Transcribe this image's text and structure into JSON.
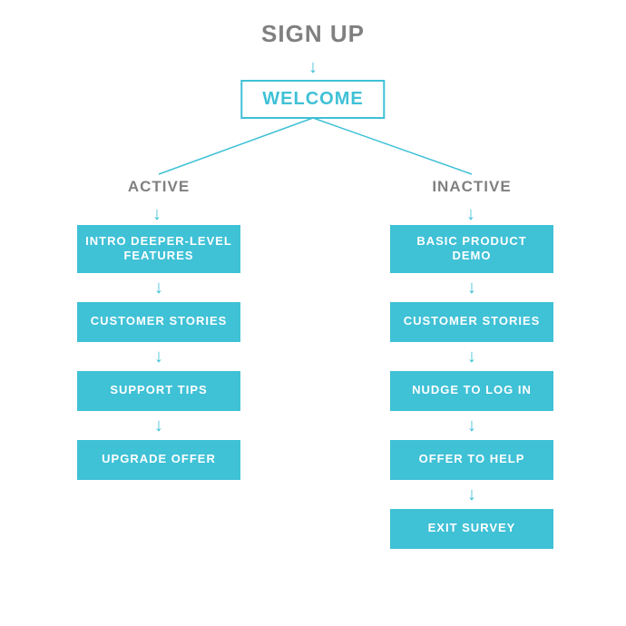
{
  "title": "SIGN UP",
  "welcome": "WELCOME",
  "branches": {
    "left": {
      "label": "ACTIVE",
      "steps": [
        "INTRO DEEPER-LEVEL FEATURES",
        "CUSTOMER STORIES",
        "SUPPORT TIPS",
        "UPGRADE OFFER"
      ]
    },
    "right": {
      "label": "INACTIVE",
      "steps": [
        "BASIC PRODUCT DEMO",
        "CUSTOMER STORIES",
        "NUDGE TO LOG IN",
        "OFFER TO HELP",
        "EXIT SURVEY"
      ]
    }
  },
  "colors": {
    "accent": "#3fc1d6",
    "muted": "#808080"
  }
}
